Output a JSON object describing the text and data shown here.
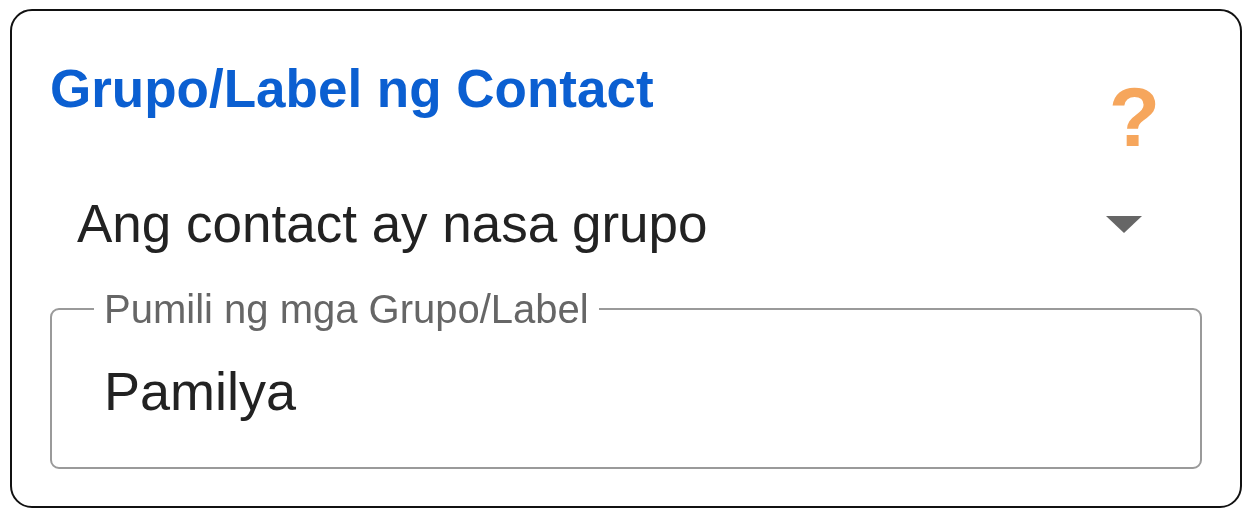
{
  "title": "Grupo/Label ng Contact",
  "help": {
    "symbol": "?"
  },
  "condition_dropdown": {
    "value": "Ang contact ay nasa grupo"
  },
  "group_field": {
    "label": "Pumili ng mga Grupo/Label",
    "value": "Pamilya"
  }
}
